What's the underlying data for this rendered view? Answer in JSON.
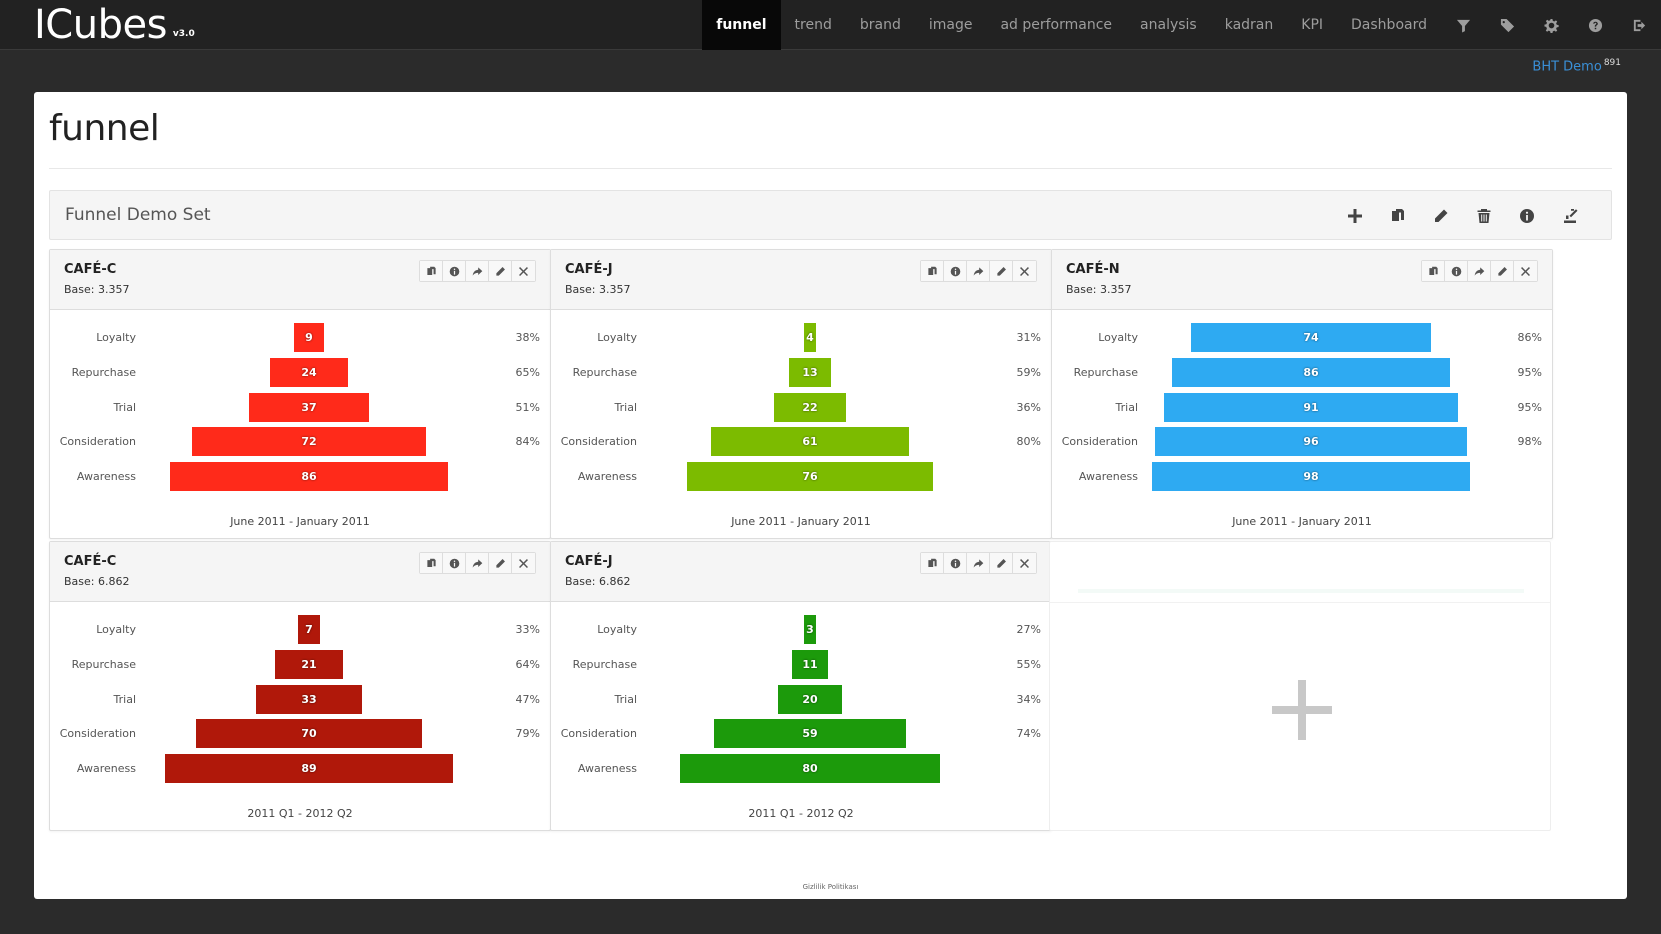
{
  "brand": {
    "name": "ICubes",
    "version": "v3.0"
  },
  "nav": {
    "items": [
      {
        "label": "funnel",
        "active": true
      },
      {
        "label": "trend"
      },
      {
        "label": "brand"
      },
      {
        "label": "image"
      },
      {
        "label": "ad performance"
      },
      {
        "label": "analysis"
      },
      {
        "label": "kadran"
      },
      {
        "label": "KPI"
      },
      {
        "label": "Dashboard"
      }
    ],
    "icons": [
      "filter-icon",
      "tags-icon",
      "gear-icon",
      "help-icon",
      "logout-icon"
    ]
  },
  "user": {
    "name": "BHT Demo",
    "count": "891"
  },
  "page": {
    "title": "funnel"
  },
  "set": {
    "title": "Funnel Demo Set",
    "tools": [
      "plus-icon",
      "copy-icon",
      "pencil-icon",
      "trash-icon",
      "info-icon",
      "export-icon"
    ]
  },
  "colors": {
    "red": "#ff2a1a",
    "lime": "#7cbb00",
    "blue": "#2eaaf2",
    "darkred": "#b0180a",
    "green": "#1c9a0b"
  },
  "cards": [
    {
      "title": "CAFÉ-C",
      "base": "Base: 3.357",
      "period": "June 2011 - January 2011",
      "color": "#ff2a1a",
      "stages": [
        {
          "label": "Loyalty",
          "value": 9,
          "pct": "38%"
        },
        {
          "label": "Repurchase",
          "value": 24,
          "pct": "65%"
        },
        {
          "label": "Trial",
          "value": 37,
          "pct": "51%"
        },
        {
          "label": "Consideration",
          "value": 72,
          "pct": "84%"
        },
        {
          "label": "Awareness",
          "value": 86,
          "pct": ""
        }
      ]
    },
    {
      "title": "CAFÉ-J",
      "base": "Base: 3.357",
      "period": "June 2011 - January 2011",
      "color": "#7cbb00",
      "stages": [
        {
          "label": "Loyalty",
          "value": 4,
          "pct": "31%"
        },
        {
          "label": "Repurchase",
          "value": 13,
          "pct": "59%"
        },
        {
          "label": "Trial",
          "value": 22,
          "pct": "36%"
        },
        {
          "label": "Consideration",
          "value": 61,
          "pct": "80%"
        },
        {
          "label": "Awareness",
          "value": 76,
          "pct": ""
        }
      ]
    },
    {
      "title": "CAFÉ-N",
      "base": "Base: 3.357",
      "period": "June 2011 - January 2011",
      "color": "#2eaaf2",
      "stages": [
        {
          "label": "Loyalty",
          "value": 74,
          "pct": "86%"
        },
        {
          "label": "Repurchase",
          "value": 86,
          "pct": "95%"
        },
        {
          "label": "Trial",
          "value": 91,
          "pct": "95%"
        },
        {
          "label": "Consideration",
          "value": 96,
          "pct": "98%"
        },
        {
          "label": "Awareness",
          "value": 98,
          "pct": ""
        }
      ]
    },
    {
      "title": "CAFÉ-C",
      "base": "Base: 6.862",
      "period": "2011 Q1 - 2012 Q2",
      "color": "#b0180a",
      "stages": [
        {
          "label": "Loyalty",
          "value": 7,
          "pct": "33%"
        },
        {
          "label": "Repurchase",
          "value": 21,
          "pct": "64%"
        },
        {
          "label": "Trial",
          "value": 33,
          "pct": "47%"
        },
        {
          "label": "Consideration",
          "value": 70,
          "pct": "79%"
        },
        {
          "label": "Awareness",
          "value": 89,
          "pct": ""
        }
      ]
    },
    {
      "title": "CAFÉ-J",
      "base": "Base: 6.862",
      "period": "2011 Q1 - 2012 Q2",
      "color": "#1c9a0b",
      "stages": [
        {
          "label": "Loyalty",
          "value": 3,
          "pct": "27%"
        },
        {
          "label": "Repurchase",
          "value": 11,
          "pct": "55%"
        },
        {
          "label": "Trial",
          "value": 20,
          "pct": "34%"
        },
        {
          "label": "Consideration",
          "value": 59,
          "pct": "74%"
        },
        {
          "label": "Awareness",
          "value": 80,
          "pct": ""
        }
      ]
    }
  ],
  "card_tools": [
    "copy-icon",
    "info-icon",
    "share-icon",
    "pencil-icon",
    "close-icon"
  ],
  "footer": {
    "text": "Gizlilik Politikası"
  }
}
